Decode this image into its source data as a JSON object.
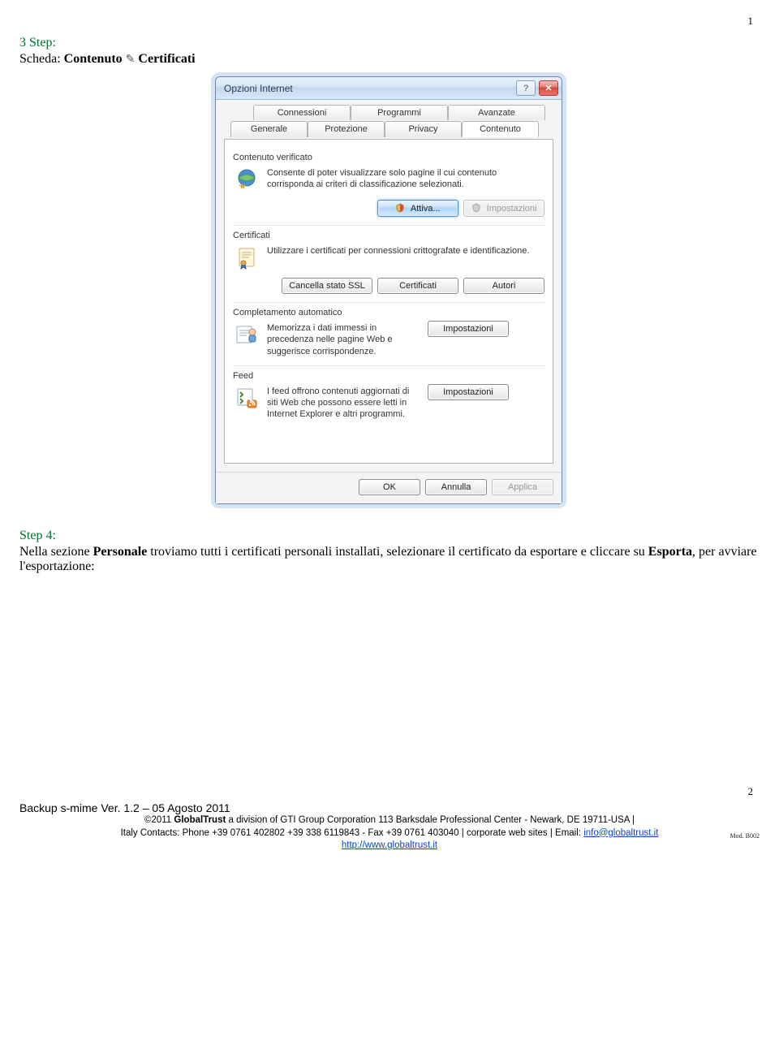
{
  "page": {
    "top_num": "1",
    "bottom_num": "2"
  },
  "step3": {
    "label": "3 Step:",
    "scheda_prefix": "Scheda: ",
    "scheda_b1": "Contenuto",
    "scheda_b2": "Certificati"
  },
  "dialog": {
    "title": "Opzioni Internet",
    "help_glyph": "?",
    "close_glyph": "✕",
    "tabs_back": [
      "Connessioni",
      "Programmi",
      "Avanzate"
    ],
    "tabs_front": [
      "Generale",
      "Protezione",
      "Privacy",
      "Contenuto"
    ],
    "group1": {
      "header": "Contenuto verificato",
      "desc": "Consente di poter visualizzare solo pagine il cui contenuto corrisponda ai criteri di classificazione selezionati.",
      "btn_attiva": "Attiva...",
      "btn_imp": "Impostazioni"
    },
    "group2": {
      "header": "Certificati",
      "desc": "Utilizzare i certificati per connessioni crittografate e identificazione.",
      "btn_ssl": "Cancella stato SSL",
      "btn_cert": "Certificati",
      "btn_autori": "Autori"
    },
    "group3": {
      "header": "Completamento automatico",
      "desc": "Memorizza i dati immessi in precedenza nelle pagine Web e suggerisce corrispondenze.",
      "btn_imp": "Impostazioni"
    },
    "group4": {
      "header": "Feed",
      "desc": "I feed offrono contenuti aggiornati di siti Web che possono essere letti in Internet Explorer e altri programmi.",
      "btn_imp": "Impostazioni"
    },
    "footer": {
      "ok": "OK",
      "cancel": "Annulla",
      "apply": "Applica"
    }
  },
  "step4": {
    "label": "Step 4:",
    "p_pre": "Nella sezione ",
    "p_b1": "Personale",
    "p_mid1": " troviamo tutti i certificati personali installati, selezionare il certificato da esportare e cliccare su ",
    "p_b2": "Esporta",
    "p_post": ", per avviare l'esportazione:"
  },
  "footer": {
    "title_plain": "Backup s-mime Ver. 1.2 – 05 Agosto 2011",
    "line1_pre": "©2011 ",
    "line1_b": "GlobalTrust",
    "line1_post": " a division of GTI Group Corporation 113 Barksdale Professional Center - Newark, DE 19711-USA |",
    "line2_pre": "Italy Contacts: Phone +39 0761 402802  +39 338 6119843 - Fax +39 0761 403040 | corporate web sites |  Email: ",
    "email": "info@globaltrust.it",
    "url": "http://www.globaltrust.it",
    "mod": "Mod. B002"
  }
}
